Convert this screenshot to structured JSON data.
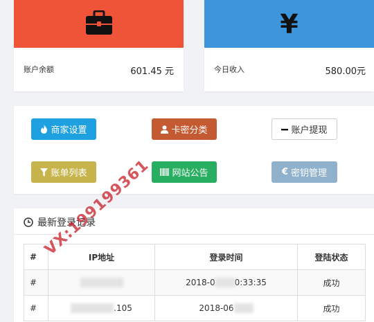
{
  "stats": [
    {
      "label": "账户余额",
      "value": "601.45 元",
      "icon": "briefcase-icon",
      "color": "#f05438"
    },
    {
      "label": "今日收入",
      "value": "580.00元",
      "icon": "yen-icon",
      "color": "#3d96dc",
      "symbol": "¥"
    }
  ],
  "buttons": [
    {
      "label": "商家设置",
      "icon": "fire-icon"
    },
    {
      "label": "卡密分类",
      "icon": "user-icon"
    },
    {
      "label": "账户提现",
      "icon": "minus-icon"
    },
    {
      "label": "账单列表",
      "icon": "filter-icon"
    },
    {
      "label": "网站公告",
      "icon": "barcode-icon"
    },
    {
      "label": "密钥管理",
      "icon": "euro-icon"
    }
  ],
  "login_log": {
    "title": "最新登录记录",
    "columns": [
      "#",
      "IP地址",
      "登录时间",
      "登陆状态"
    ],
    "rows": [
      {
        "index": "#",
        "ip": "",
        "time": "2018-0",
        "time_tail": "0:33:35",
        "status": "成功"
      },
      {
        "index": "#",
        "ip_tail": ".105",
        "time": "2018-06",
        "status": "成功"
      }
    ]
  },
  "watermark": "VX:199199361"
}
